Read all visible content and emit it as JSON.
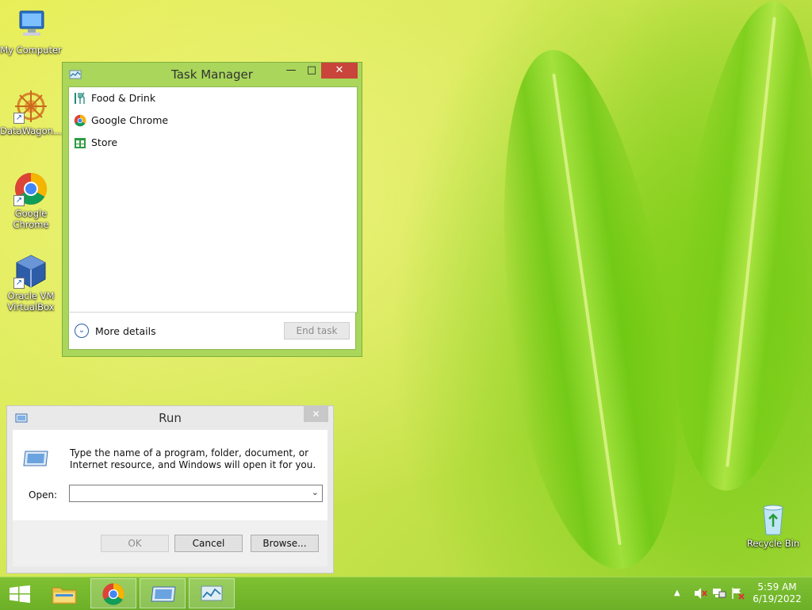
{
  "desktop": {
    "icons": [
      {
        "label": "My Computer"
      },
      {
        "label": "DataWagon..."
      },
      {
        "label": "Google Chrome"
      },
      {
        "label": "Oracle VM VirtualBox"
      },
      {
        "label": "Recycle Bin"
      }
    ]
  },
  "task_manager": {
    "title": "Task Manager",
    "apps": [
      {
        "name": "Food & Drink",
        "icon": "food-drink-icon"
      },
      {
        "name": "Google Chrome",
        "icon": "chrome-icon"
      },
      {
        "name": "Store",
        "icon": "store-icon"
      }
    ],
    "more_details": "More details",
    "end_task": "End task"
  },
  "run": {
    "title": "Run",
    "description": "Type the name of a program, folder, document, or Internet resource, and Windows will open it for you.",
    "open_label": "Open:",
    "open_value": "",
    "buttons": {
      "ok": "OK",
      "cancel": "Cancel",
      "browse": "Browse..."
    }
  },
  "taskbar": {
    "time": "5:59 AM",
    "date": "6/19/2022"
  },
  "colors": {
    "accent": "#a9d65b",
    "close": "#c9443a",
    "taskbar": "#74b82c"
  }
}
